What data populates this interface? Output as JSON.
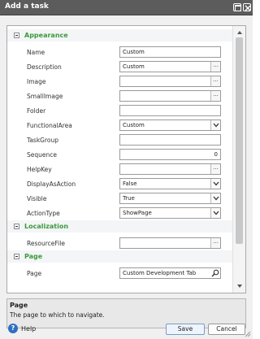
{
  "window": {
    "title": "Add a task"
  },
  "grid": {
    "rows": [
      {
        "kind": "section",
        "label": "Appearance"
      },
      {
        "kind": "prop",
        "name": "Name",
        "value": "Custom",
        "editor": "text"
      },
      {
        "kind": "prop",
        "name": "Description",
        "value": "Custom",
        "editor": "ellipsis"
      },
      {
        "kind": "prop",
        "name": "Image",
        "value": "",
        "editor": "ellipsis"
      },
      {
        "kind": "prop",
        "name": "SmallImage",
        "value": "",
        "editor": "ellipsis"
      },
      {
        "kind": "prop",
        "name": "Folder",
        "value": "",
        "editor": "text"
      },
      {
        "kind": "prop",
        "name": "FunctionalArea",
        "value": "Custom",
        "editor": "dropdown"
      },
      {
        "kind": "prop",
        "name": "TaskGroup",
        "value": "",
        "editor": "text"
      },
      {
        "kind": "prop",
        "name": "Sequence",
        "value": "0",
        "editor": "number"
      },
      {
        "kind": "prop",
        "name": "HelpKey",
        "value": "",
        "editor": "ellipsis"
      },
      {
        "kind": "prop",
        "name": "DisplayAsAction",
        "value": "False",
        "editor": "dropdown"
      },
      {
        "kind": "prop",
        "name": "Visible",
        "value": "True",
        "editor": "dropdown"
      },
      {
        "kind": "prop",
        "name": "ActionType",
        "value": "ShowPage",
        "editor": "dropdown"
      },
      {
        "kind": "section",
        "label": "Localization"
      },
      {
        "kind": "prop",
        "name": "ResourceFile",
        "value": "",
        "editor": "ellipsis"
      },
      {
        "kind": "section",
        "label": "Page"
      },
      {
        "kind": "prop",
        "name": "Page",
        "value": "Custom Development Tab",
        "editor": "search"
      }
    ]
  },
  "description": {
    "title": "Page",
    "text": "The page to which to navigate."
  },
  "footer": {
    "help_label": "Help",
    "help_icon_glyph": "?",
    "save_label": "Save",
    "cancel_label": "Cancel"
  },
  "colors": {
    "section_label": "#3c9a3c",
    "title_bar": "#5c5c5c",
    "help_icon": "#2f6fc0"
  }
}
